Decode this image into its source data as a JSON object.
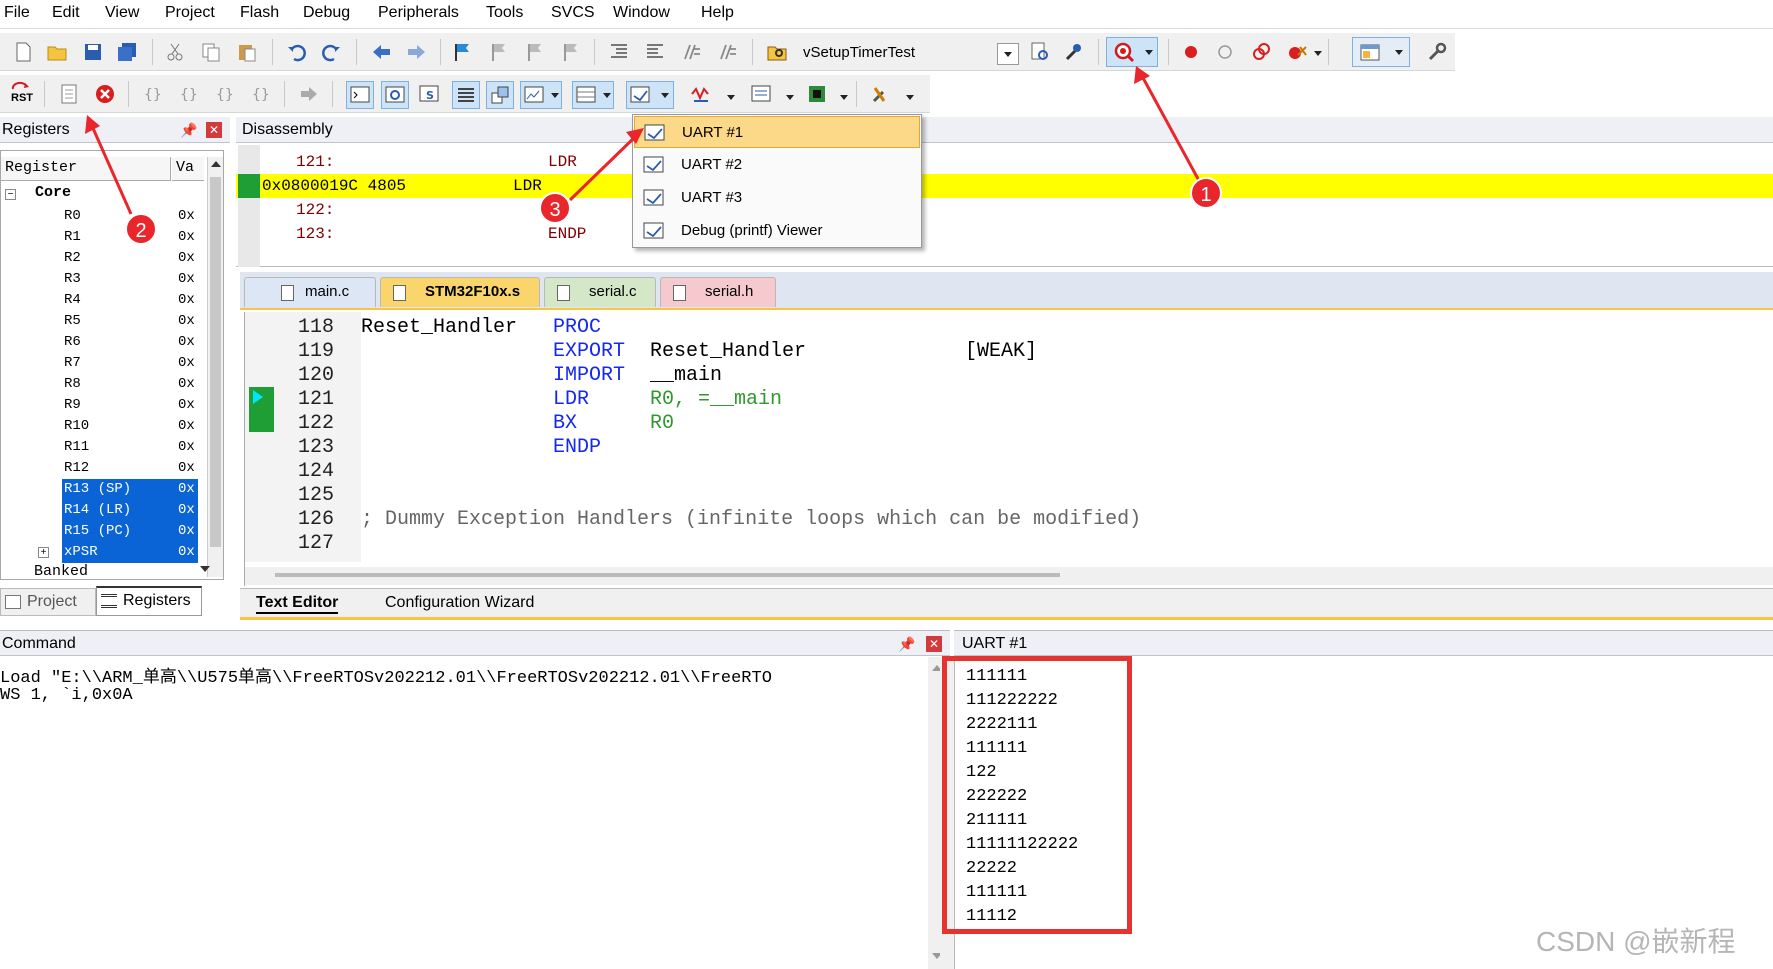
{
  "menu": [
    "File",
    "Edit",
    "View",
    "Project",
    "Flash",
    "Debug",
    "Peripherals",
    "Tools",
    "SVCS",
    "Window",
    "Help"
  ],
  "toolbar": {
    "target_name": "vSetupTimerTest",
    "reset_label": "RST"
  },
  "registers_panel": {
    "title": "Registers",
    "col_register": "Register",
    "col_value": "Va",
    "group_core": "Core",
    "group_banked": "Banked",
    "rows": [
      {
        "name": "R0",
        "value": "0x"
      },
      {
        "name": "R1",
        "value": "0x"
      },
      {
        "name": "R2",
        "value": "0x"
      },
      {
        "name": "R3",
        "value": "0x"
      },
      {
        "name": "R4",
        "value": "0x"
      },
      {
        "name": "R5",
        "value": "0x"
      },
      {
        "name": "R6",
        "value": "0x"
      },
      {
        "name": "R7",
        "value": "0x"
      },
      {
        "name": "R8",
        "value": "0x"
      },
      {
        "name": "R9",
        "value": "0x"
      },
      {
        "name": "R10",
        "value": "0x"
      },
      {
        "name": "R11",
        "value": "0x"
      },
      {
        "name": "R12",
        "value": "0x"
      },
      {
        "name": "R13 (SP)",
        "value": "0x"
      },
      {
        "name": "R14 (LR)",
        "value": "0x"
      },
      {
        "name": "R15 (PC)",
        "value": "0x"
      },
      {
        "name": "xPSR",
        "value": "0x"
      }
    ],
    "tabs": [
      "Project",
      "Registers"
    ]
  },
  "disassembly": {
    "title": "Disassembly",
    "lines": [
      {
        "text": "121:",
        "mnemonic": "LDR"
      },
      {
        "text": "0x0800019C 4805",
        "mnemonic": "LDR"
      },
      {
        "text": "122:",
        "mnemonic": "BX"
      },
      {
        "text": "123:",
        "mnemonic": "ENDP"
      }
    ]
  },
  "serial_menu": {
    "items": [
      "UART #1",
      "UART #2",
      "UART #3",
      "Debug (printf) Viewer"
    ]
  },
  "editor": {
    "tabs": [
      "main.c",
      "STM32F10x.s",
      "serial.c",
      "serial.h"
    ],
    "active_tab": "STM32F10x.s",
    "lines": [
      {
        "num": "118",
        "label": "Reset_Handler",
        "op": "PROC",
        "arg": "",
        "extra": ""
      },
      {
        "num": "119",
        "label": "",
        "op": "EXPORT",
        "arg": "Reset_Handler",
        "extra": "[WEAK]"
      },
      {
        "num": "120",
        "label": "",
        "op": "IMPORT",
        "arg": "__main",
        "extra": ""
      },
      {
        "num": "121",
        "label": "",
        "op": "LDR",
        "arg": "R0, =__main",
        "extra": ""
      },
      {
        "num": "122",
        "label": "",
        "op": "BX",
        "arg": "R0",
        "extra": ""
      },
      {
        "num": "123",
        "label": "",
        "op": "ENDP",
        "arg": "",
        "extra": ""
      },
      {
        "num": "124",
        "label": "",
        "op": "",
        "arg": "",
        "extra": ""
      },
      {
        "num": "125",
        "label": "",
        "op": "",
        "arg": "",
        "extra": ""
      },
      {
        "num": "126",
        "label": "; Dummy Exception Handlers (infinite loops which can be modified)",
        "op": "",
        "arg": "",
        "extra": ""
      },
      {
        "num": "127",
        "label": "",
        "op": "",
        "arg": "",
        "extra": ""
      }
    ],
    "bottom_tabs": [
      "Text Editor",
      "Configuration Wizard"
    ]
  },
  "command": {
    "title": "Command",
    "lines": [
      "Load \"E:\\\\ARM_单高\\\\U575单高\\\\FreeRTOSv202212.01\\\\FreeRTOSv202212.01\\\\FreeRTO",
      "WS 1, `i,0x0A"
    ]
  },
  "uart": {
    "title": "UART #1",
    "output": [
      "111111",
      "111222222",
      "2222111",
      "111111",
      "122",
      "222222",
      "211111",
      "11111122222",
      "22222",
      "111111",
      "11112"
    ]
  },
  "annotations": [
    "1",
    "2",
    "3"
  ],
  "watermark": "CSDN @嵌新程"
}
